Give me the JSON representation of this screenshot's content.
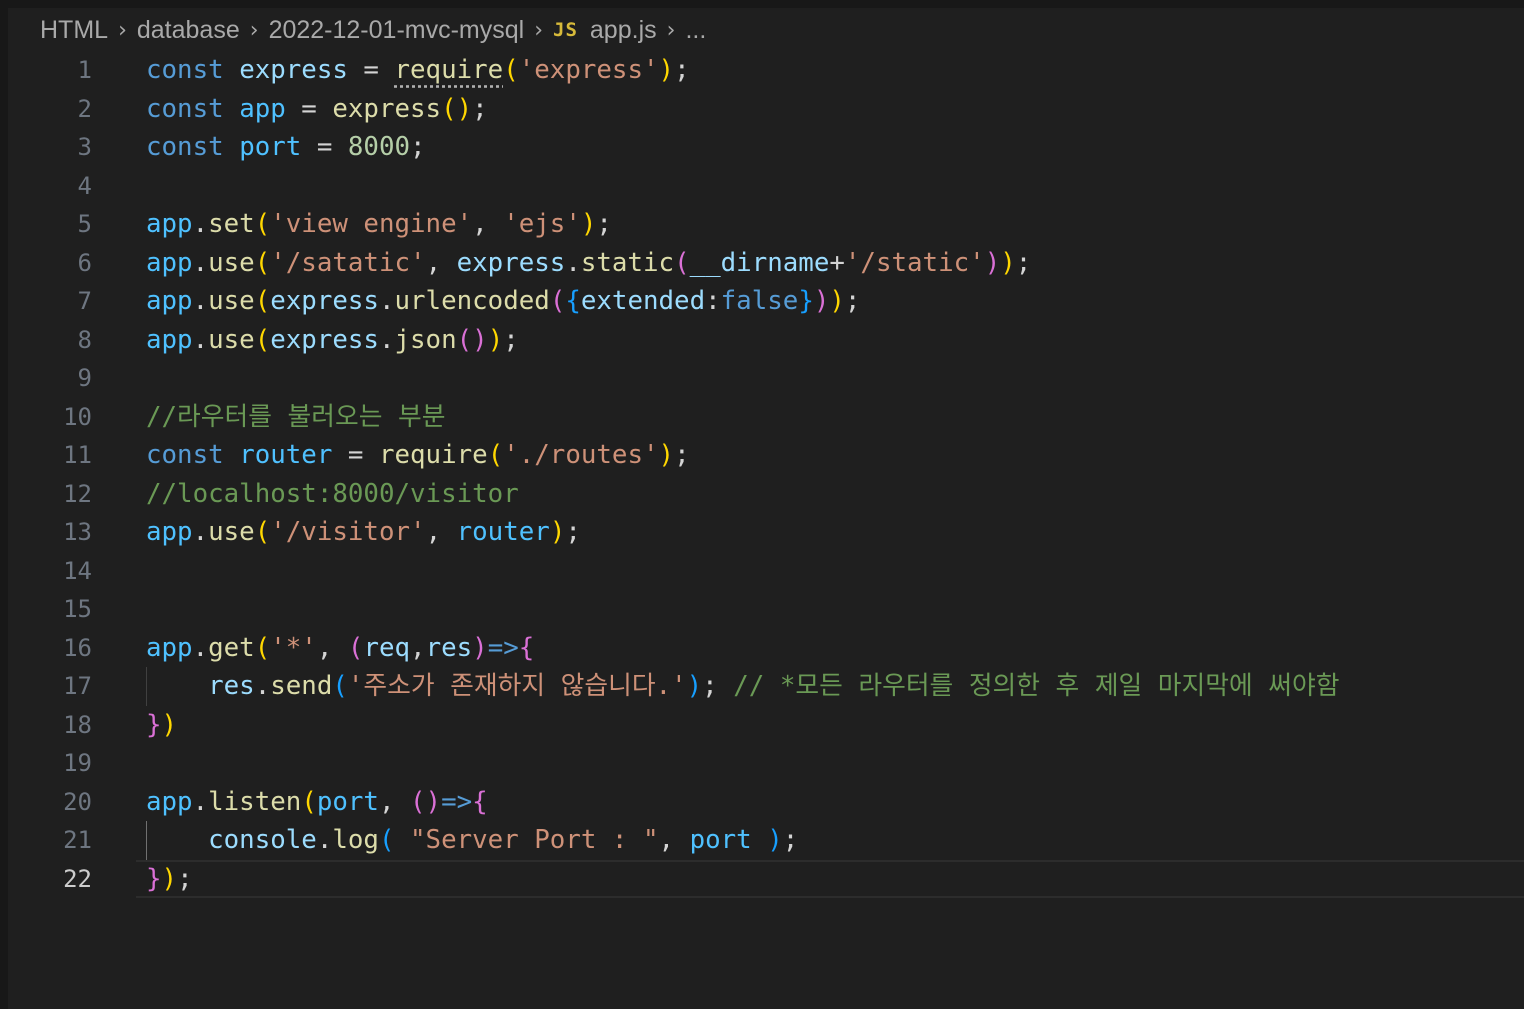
{
  "breadcrumb": {
    "items": [
      "HTML",
      "database",
      "2022-12-01-mvc-mysql"
    ],
    "file_icon": "JS",
    "file_name": "app.js",
    "more": "..."
  },
  "editor": {
    "active_line": 22,
    "lines": [
      {
        "n": "1",
        "tokens": [
          {
            "t": "const",
            "c": "kw"
          },
          {
            "t": " ",
            "c": "p"
          },
          {
            "t": "express",
            "c": "obj"
          },
          {
            "t": " = ",
            "c": "op"
          },
          {
            "t": "require",
            "c": "fn",
            "squiggle": true
          },
          {
            "t": "(",
            "c": "b1"
          },
          {
            "t": "'express'",
            "c": "str"
          },
          {
            "t": ")",
            "c": "b1"
          },
          {
            "t": ";",
            "c": "p"
          }
        ]
      },
      {
        "n": "2",
        "tokens": [
          {
            "t": "const",
            "c": "kw"
          },
          {
            "t": " ",
            "c": "p"
          },
          {
            "t": "app",
            "c": "var"
          },
          {
            "t": " = ",
            "c": "op"
          },
          {
            "t": "express",
            "c": "fn"
          },
          {
            "t": "()",
            "c": "b1"
          },
          {
            "t": ";",
            "c": "p"
          }
        ]
      },
      {
        "n": "3",
        "tokens": [
          {
            "t": "const",
            "c": "kw"
          },
          {
            "t": " ",
            "c": "p"
          },
          {
            "t": "port",
            "c": "var"
          },
          {
            "t": " = ",
            "c": "op"
          },
          {
            "t": "8000",
            "c": "num"
          },
          {
            "t": ";",
            "c": "p"
          }
        ]
      },
      {
        "n": "4",
        "tokens": []
      },
      {
        "n": "5",
        "tokens": [
          {
            "t": "app",
            "c": "var"
          },
          {
            "t": ".",
            "c": "p"
          },
          {
            "t": "set",
            "c": "fn"
          },
          {
            "t": "(",
            "c": "b1"
          },
          {
            "t": "'view engine'",
            "c": "str"
          },
          {
            "t": ", ",
            "c": "p"
          },
          {
            "t": "'ejs'",
            "c": "str"
          },
          {
            "t": ")",
            "c": "b1"
          },
          {
            "t": ";",
            "c": "p"
          }
        ]
      },
      {
        "n": "6",
        "tokens": [
          {
            "t": "app",
            "c": "var"
          },
          {
            "t": ".",
            "c": "p"
          },
          {
            "t": "use",
            "c": "fn"
          },
          {
            "t": "(",
            "c": "b1"
          },
          {
            "t": "'/satatic'",
            "c": "str"
          },
          {
            "t": ", ",
            "c": "p"
          },
          {
            "t": "express",
            "c": "obj"
          },
          {
            "t": ".",
            "c": "p"
          },
          {
            "t": "static",
            "c": "fn"
          },
          {
            "t": "(",
            "c": "b2"
          },
          {
            "t": "__dirname",
            "c": "obj"
          },
          {
            "t": "+",
            "c": "op"
          },
          {
            "t": "'/static'",
            "c": "str"
          },
          {
            "t": ")",
            "c": "b2"
          },
          {
            "t": ")",
            "c": "b1"
          },
          {
            "t": ";",
            "c": "p"
          }
        ]
      },
      {
        "n": "7",
        "tokens": [
          {
            "t": "app",
            "c": "var"
          },
          {
            "t": ".",
            "c": "p"
          },
          {
            "t": "use",
            "c": "fn"
          },
          {
            "t": "(",
            "c": "b1"
          },
          {
            "t": "express",
            "c": "obj"
          },
          {
            "t": ".",
            "c": "p"
          },
          {
            "t": "urlencoded",
            "c": "fn"
          },
          {
            "t": "(",
            "c": "b2"
          },
          {
            "t": "{",
            "c": "b3"
          },
          {
            "t": "extended",
            "c": "obj"
          },
          {
            "t": ":",
            "c": "p"
          },
          {
            "t": "false",
            "c": "kw"
          },
          {
            "t": "}",
            "c": "b3"
          },
          {
            "t": ")",
            "c": "b2"
          },
          {
            "t": ")",
            "c": "b1"
          },
          {
            "t": ";",
            "c": "p"
          }
        ]
      },
      {
        "n": "8",
        "tokens": [
          {
            "t": "app",
            "c": "var"
          },
          {
            "t": ".",
            "c": "p"
          },
          {
            "t": "use",
            "c": "fn"
          },
          {
            "t": "(",
            "c": "b1"
          },
          {
            "t": "express",
            "c": "obj"
          },
          {
            "t": ".",
            "c": "p"
          },
          {
            "t": "json",
            "c": "fn"
          },
          {
            "t": "()",
            "c": "b2"
          },
          {
            "t": ")",
            "c": "b1"
          },
          {
            "t": ";",
            "c": "p"
          }
        ]
      },
      {
        "n": "9",
        "tokens": []
      },
      {
        "n": "10",
        "tokens": [
          {
            "t": "//라우터를 불러오는 부분",
            "c": "com"
          }
        ]
      },
      {
        "n": "11",
        "tokens": [
          {
            "t": "const",
            "c": "kw"
          },
          {
            "t": " ",
            "c": "p"
          },
          {
            "t": "router",
            "c": "var"
          },
          {
            "t": " = ",
            "c": "op"
          },
          {
            "t": "require",
            "c": "fn"
          },
          {
            "t": "(",
            "c": "b1"
          },
          {
            "t": "'./routes'",
            "c": "str"
          },
          {
            "t": ")",
            "c": "b1"
          },
          {
            "t": ";",
            "c": "p"
          }
        ]
      },
      {
        "n": "12",
        "tokens": [
          {
            "t": "//localhost:8000/visitor",
            "c": "com"
          }
        ]
      },
      {
        "n": "13",
        "tokens": [
          {
            "t": "app",
            "c": "var"
          },
          {
            "t": ".",
            "c": "p"
          },
          {
            "t": "use",
            "c": "fn"
          },
          {
            "t": "(",
            "c": "b1"
          },
          {
            "t": "'/visitor'",
            "c": "str"
          },
          {
            "t": ", ",
            "c": "p"
          },
          {
            "t": "router",
            "c": "var"
          },
          {
            "t": ")",
            "c": "b1"
          },
          {
            "t": ";",
            "c": "p"
          }
        ]
      },
      {
        "n": "14",
        "tokens": []
      },
      {
        "n": "15",
        "tokens": []
      },
      {
        "n": "16",
        "tokens": [
          {
            "t": "app",
            "c": "var"
          },
          {
            "t": ".",
            "c": "p"
          },
          {
            "t": "get",
            "c": "fn"
          },
          {
            "t": "(",
            "c": "b1"
          },
          {
            "t": "'*'",
            "c": "str"
          },
          {
            "t": ", ",
            "c": "p"
          },
          {
            "t": "(",
            "c": "b2"
          },
          {
            "t": "req",
            "c": "obj"
          },
          {
            "t": ",",
            "c": "p"
          },
          {
            "t": "res",
            "c": "obj"
          },
          {
            "t": ")",
            "c": "b2"
          },
          {
            "t": "=>",
            "c": "kw"
          },
          {
            "t": "{",
            "c": "b2"
          }
        ]
      },
      {
        "n": "17",
        "guide": true,
        "tokens": [
          {
            "t": "    ",
            "c": "p"
          },
          {
            "t": "res",
            "c": "obj"
          },
          {
            "t": ".",
            "c": "p"
          },
          {
            "t": "send",
            "c": "fn"
          },
          {
            "t": "(",
            "c": "b3"
          },
          {
            "t": "'주소가 존재하지 않습니다.'",
            "c": "str"
          },
          {
            "t": ")",
            "c": "b3"
          },
          {
            "t": "; ",
            "c": "p"
          },
          {
            "t": "// *모든 라우터를 정의한 후 제일 마지막에 써야함",
            "c": "com"
          }
        ]
      },
      {
        "n": "18",
        "tokens": [
          {
            "t": "}",
            "c": "b2"
          },
          {
            "t": ")",
            "c": "b1"
          }
        ]
      },
      {
        "n": "19",
        "tokens": []
      },
      {
        "n": "20",
        "tokens": [
          {
            "t": "app",
            "c": "var"
          },
          {
            "t": ".",
            "c": "p"
          },
          {
            "t": "listen",
            "c": "fn"
          },
          {
            "t": "(",
            "c": "b1"
          },
          {
            "t": "port",
            "c": "var"
          },
          {
            "t": ", ",
            "c": "p"
          },
          {
            "t": "()",
            "c": "b2"
          },
          {
            "t": "=>",
            "c": "kw"
          },
          {
            "t": "{",
            "c": "b2"
          }
        ]
      },
      {
        "n": "21",
        "guide": true,
        "guide_active": true,
        "tokens": [
          {
            "t": "    ",
            "c": "p"
          },
          {
            "t": "console",
            "c": "obj"
          },
          {
            "t": ".",
            "c": "p"
          },
          {
            "t": "log",
            "c": "fn"
          },
          {
            "t": "( ",
            "c": "b3"
          },
          {
            "t": "\"Server Port : \"",
            "c": "str"
          },
          {
            "t": ", ",
            "c": "p"
          },
          {
            "t": "port",
            "c": "var"
          },
          {
            "t": " )",
            "c": "b3"
          },
          {
            "t": ";",
            "c": "p"
          }
        ]
      },
      {
        "n": "22",
        "tokens": [
          {
            "t": "}",
            "c": "b2"
          },
          {
            "t": ")",
            "c": "b1"
          },
          {
            "t": ";",
            "c": "p"
          }
        ]
      }
    ]
  },
  "colors": {
    "background": "#1f1f1f",
    "keyword": "#569cd6",
    "variable": "#4fc1ff",
    "property": "#9cdcfe",
    "function": "#dcdcaa",
    "string": "#ce9178",
    "number": "#b5cea8",
    "comment": "#6a9955",
    "bracket_1": "#ffd700",
    "bracket_2": "#da70d6",
    "bracket_3": "#179fff"
  },
  "icons": {
    "breadcrumb_separator": "chevron-right-icon",
    "file_type": "javascript-file-icon"
  }
}
